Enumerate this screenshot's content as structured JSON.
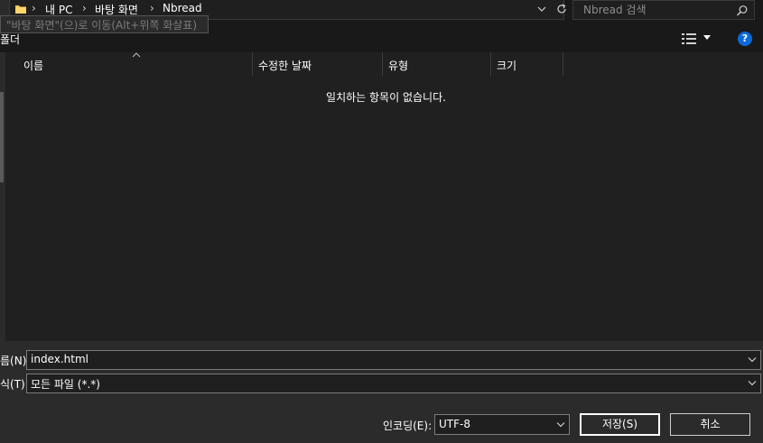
{
  "address_bar": {
    "breadcrumbs": [
      "내 PC",
      "바탕 화면",
      "Nbread"
    ],
    "folder_icon": "folder-icon",
    "refresh_icon": "refresh-icon"
  },
  "tooltip": {
    "text": "\"바탕 화면\"(으)로 이동(Alt+위쪽 화살표)"
  },
  "search": {
    "placeholder": "Nbread 검색"
  },
  "toolbar": {
    "new_folder_label": "폴더"
  },
  "file_list": {
    "columns": [
      "이름",
      "수정한 날짜",
      "유형",
      "크기"
    ],
    "sorted_column": "이름",
    "empty_message": "일치하는 항목이 없습니다."
  },
  "save_form": {
    "filename_label": "름(N):",
    "filename_value": "index.html",
    "filetype_label": "식(T):",
    "filetype_value": "모든 파일 (*.*)",
    "encoding_label": "인코딩(E):",
    "encoding_value": "UTF-8",
    "save_label": "저장(S)",
    "cancel_label": "취소"
  },
  "colors": {
    "background": "#191919",
    "panel": "#2b2b2b",
    "list_bg": "#202020",
    "accent_help": "#0a6bd8"
  }
}
